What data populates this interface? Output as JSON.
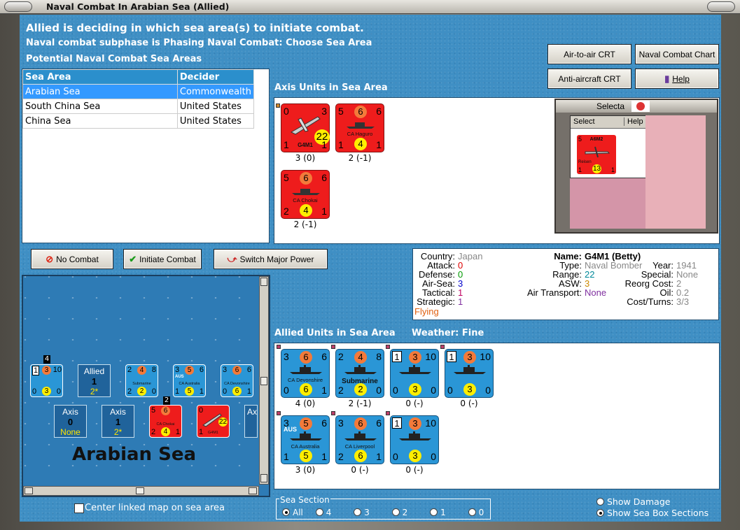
{
  "window": {
    "title": "Naval Combat In Arabian Sea (Allied)"
  },
  "header": {
    "line1": "Allied is deciding in which sea area(s) to initiate combat.",
    "line2": "Naval combat subphase is Phasing Naval Combat: Choose Sea Area",
    "line3": "Potential Naval Combat Sea Areas"
  },
  "toolbar": {
    "air_to_air": "Air-to-air CRT",
    "naval_chart": "Naval Combat Chart",
    "anti_aircraft": "Anti-aircraft CRT",
    "help": "Help"
  },
  "sea_areas": {
    "columns": [
      "Sea Area",
      "Decider"
    ],
    "rows": [
      {
        "area": "Arabian Sea",
        "decider": "Commonwealth",
        "selected": true
      },
      {
        "area": "South China Sea",
        "decider": "United States",
        "selected": false
      },
      {
        "area": "China Sea",
        "decider": "United States",
        "selected": false
      }
    ]
  },
  "axis_section": {
    "title": "Axis Units in Sea Area"
  },
  "axis_units": [
    {
      "name": "G4M1",
      "tl": "0",
      "tr": "3",
      "bl": "1",
      "br": "1",
      "circle": "22",
      "circle_big": true,
      "caption": "3 (0)",
      "type": "plane"
    },
    {
      "name": "CA Haguro",
      "tl": "5",
      "top": "6",
      "tr": "6",
      "bl": "1",
      "br": "1",
      "circle": "4",
      "caption": "2 (-1)",
      "type": "ship"
    },
    {
      "name": "CA Chokai",
      "tl": "5",
      "top": "6",
      "tr": "6",
      "bl": "2",
      "br": "1",
      "circle": "4",
      "caption": "2 (-1)",
      "type": "ship"
    }
  ],
  "select_popup": {
    "title": "Selecta",
    "select": "Select",
    "help": "Help",
    "unit": {
      "name": "A6M2",
      "sub": "Reisen",
      "tl": "5",
      "bl": "1",
      "br": "1",
      "circle": "13"
    }
  },
  "actions": {
    "no_combat": "No Combat",
    "initiate": "Initiate Combat",
    "switch_power": "Switch Major Power"
  },
  "map": {
    "sea_name": "Arabian Sea",
    "stack_count": "4",
    "stack_count2": "2",
    "allied_box": {
      "label": "Allied",
      "num": "1",
      "val": "2*"
    },
    "axis_box1": {
      "label": "Axis",
      "num": "0",
      "val": "None"
    },
    "axis_box2": {
      "label": "Axis",
      "num": "1",
      "val": "2*"
    },
    "axis_box3": {
      "label": "Ax"
    },
    "minis": [
      {
        "tl": "1",
        "top": "3",
        "tr": "10",
        "bl": "0",
        "mid": "3",
        "br": "0",
        "name": ""
      },
      {
        "tl": "2",
        "top": "4",
        "tr": "8",
        "bl": "2",
        "mid": "2",
        "br": "0",
        "name": "Submarine"
      },
      {
        "tl": "3",
        "top": "5",
        "tr": "6",
        "bl": "1",
        "mid": "5",
        "br": "1",
        "name": "CA Australia",
        "tag": "AUS"
      },
      {
        "tl": "3",
        "top": "6",
        "tr": "6",
        "bl": "0",
        "mid": "6",
        "br": "1",
        "name": "CA Devonshire"
      },
      {
        "tl": "5",
        "top": "6",
        "tr": "",
        "bl": "2",
        "mid": "4",
        "br": "1",
        "name": "CA Chokai"
      },
      {
        "tl": "0",
        "top": "",
        "tr": "",
        "bl": "1",
        "mid": "22",
        "br": "",
        "name": "G4M1"
      }
    ]
  },
  "details": {
    "country_label": "Country:",
    "country": "Japan",
    "attack_label": "Attack:",
    "attack": "0",
    "defense_label": "Defense:",
    "defense": "0",
    "airsea_label": "Air-Sea:",
    "airsea": "3",
    "tactical_label": "Tactical:",
    "tactical": "1",
    "strategic_label": "Strategic:",
    "strategic": "1",
    "flying": "Flying",
    "name_label": "Name:",
    "name": "G4M1 (Betty)",
    "type_label": "Type:",
    "type": "Naval Bomber",
    "year_label": "Year:",
    "year": "1941",
    "range_label": "Range:",
    "range": "22",
    "special_label": "Special:",
    "special": "None",
    "asw_label": "ASW:",
    "asw": "3",
    "reorg_label": "Reorg Cost:",
    "reorg": "2",
    "transport_label": "Air Transport:",
    "transport": "None",
    "oil_label": "Oil:",
    "oil": "0.2",
    "cost_label": "Cost/Turns:",
    "cost": "3/3"
  },
  "allied_section": {
    "title": "Allied Units in Sea Area",
    "weather": "Weather:  Fine"
  },
  "allied_units": [
    {
      "name": "CA Devonshire",
      "tl": "3",
      "top": "6",
      "tr": "6",
      "bl": "0",
      "mid": "6",
      "br": "1",
      "caption": "4 (0)"
    },
    {
      "name": "Submarine",
      "tl": "2",
      "top": "4",
      "tr": "8",
      "bl": "2",
      "mid": "2",
      "br": "0",
      "caption": "2 (-1)"
    },
    {
      "name": "",
      "tl": "1",
      "top": "3",
      "tr": "10",
      "bl": "0",
      "mid": "3",
      "br": "0",
      "caption": "0 (-)",
      "box": true
    },
    {
      "name": "",
      "tl": "1",
      "top": "3",
      "tr": "10",
      "bl": "0",
      "mid": "3",
      "br": "0",
      "caption": "0 (-)",
      "box": true
    },
    {
      "name": "CA Australia",
      "tl": "3",
      "top": "5",
      "tr": "6",
      "bl": "1",
      "mid": "5",
      "br": "1",
      "caption": "3 (0)",
      "tag": "AUS"
    },
    {
      "name": "CA Liverpool",
      "tl": "3",
      "top": "6",
      "tr": "6",
      "bl": "2",
      "mid": "6",
      "br": "1",
      "caption": "0 (-)"
    },
    {
      "name": "",
      "tl": "1",
      "top": "3",
      "tr": "10",
      "bl": "0",
      "mid": "3",
      "br": "0",
      "caption": "0 (-)",
      "box": true
    }
  ],
  "options": {
    "center_map": "Center linked map on sea area",
    "sea_section": "Sea Section",
    "sections": [
      "All",
      "4",
      "3",
      "2",
      "1",
      "0"
    ],
    "show_damage": "Show Damage",
    "show_boxes": "Show Sea Box Sections"
  }
}
